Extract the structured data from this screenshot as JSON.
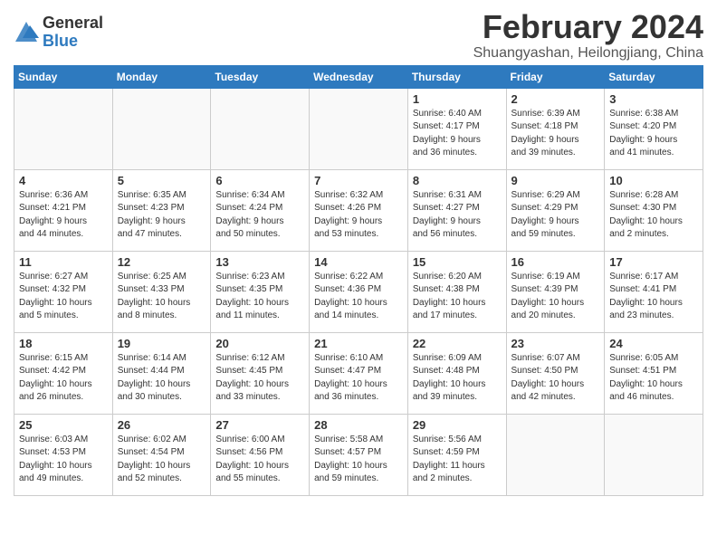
{
  "logo": {
    "general": "General",
    "blue": "Blue"
  },
  "header": {
    "month": "February 2024",
    "location": "Shuangyashan, Heilongjiang, China"
  },
  "weekdays": [
    "Sunday",
    "Monday",
    "Tuesday",
    "Wednesday",
    "Thursday",
    "Friday",
    "Saturday"
  ],
  "weeks": [
    [
      {
        "day": "",
        "info": ""
      },
      {
        "day": "",
        "info": ""
      },
      {
        "day": "",
        "info": ""
      },
      {
        "day": "",
        "info": ""
      },
      {
        "day": "1",
        "info": "Sunrise: 6:40 AM\nSunset: 4:17 PM\nDaylight: 9 hours\nand 36 minutes."
      },
      {
        "day": "2",
        "info": "Sunrise: 6:39 AM\nSunset: 4:18 PM\nDaylight: 9 hours\nand 39 minutes."
      },
      {
        "day": "3",
        "info": "Sunrise: 6:38 AM\nSunset: 4:20 PM\nDaylight: 9 hours\nand 41 minutes."
      }
    ],
    [
      {
        "day": "4",
        "info": "Sunrise: 6:36 AM\nSunset: 4:21 PM\nDaylight: 9 hours\nand 44 minutes."
      },
      {
        "day": "5",
        "info": "Sunrise: 6:35 AM\nSunset: 4:23 PM\nDaylight: 9 hours\nand 47 minutes."
      },
      {
        "day": "6",
        "info": "Sunrise: 6:34 AM\nSunset: 4:24 PM\nDaylight: 9 hours\nand 50 minutes."
      },
      {
        "day": "7",
        "info": "Sunrise: 6:32 AM\nSunset: 4:26 PM\nDaylight: 9 hours\nand 53 minutes."
      },
      {
        "day": "8",
        "info": "Sunrise: 6:31 AM\nSunset: 4:27 PM\nDaylight: 9 hours\nand 56 minutes."
      },
      {
        "day": "9",
        "info": "Sunrise: 6:29 AM\nSunset: 4:29 PM\nDaylight: 9 hours\nand 59 minutes."
      },
      {
        "day": "10",
        "info": "Sunrise: 6:28 AM\nSunset: 4:30 PM\nDaylight: 10 hours\nand 2 minutes."
      }
    ],
    [
      {
        "day": "11",
        "info": "Sunrise: 6:27 AM\nSunset: 4:32 PM\nDaylight: 10 hours\nand 5 minutes."
      },
      {
        "day": "12",
        "info": "Sunrise: 6:25 AM\nSunset: 4:33 PM\nDaylight: 10 hours\nand 8 minutes."
      },
      {
        "day": "13",
        "info": "Sunrise: 6:23 AM\nSunset: 4:35 PM\nDaylight: 10 hours\nand 11 minutes."
      },
      {
        "day": "14",
        "info": "Sunrise: 6:22 AM\nSunset: 4:36 PM\nDaylight: 10 hours\nand 14 minutes."
      },
      {
        "day": "15",
        "info": "Sunrise: 6:20 AM\nSunset: 4:38 PM\nDaylight: 10 hours\nand 17 minutes."
      },
      {
        "day": "16",
        "info": "Sunrise: 6:19 AM\nSunset: 4:39 PM\nDaylight: 10 hours\nand 20 minutes."
      },
      {
        "day": "17",
        "info": "Sunrise: 6:17 AM\nSunset: 4:41 PM\nDaylight: 10 hours\nand 23 minutes."
      }
    ],
    [
      {
        "day": "18",
        "info": "Sunrise: 6:15 AM\nSunset: 4:42 PM\nDaylight: 10 hours\nand 26 minutes."
      },
      {
        "day": "19",
        "info": "Sunrise: 6:14 AM\nSunset: 4:44 PM\nDaylight: 10 hours\nand 30 minutes."
      },
      {
        "day": "20",
        "info": "Sunrise: 6:12 AM\nSunset: 4:45 PM\nDaylight: 10 hours\nand 33 minutes."
      },
      {
        "day": "21",
        "info": "Sunrise: 6:10 AM\nSunset: 4:47 PM\nDaylight: 10 hours\nand 36 minutes."
      },
      {
        "day": "22",
        "info": "Sunrise: 6:09 AM\nSunset: 4:48 PM\nDaylight: 10 hours\nand 39 minutes."
      },
      {
        "day": "23",
        "info": "Sunrise: 6:07 AM\nSunset: 4:50 PM\nDaylight: 10 hours\nand 42 minutes."
      },
      {
        "day": "24",
        "info": "Sunrise: 6:05 AM\nSunset: 4:51 PM\nDaylight: 10 hours\nand 46 minutes."
      }
    ],
    [
      {
        "day": "25",
        "info": "Sunrise: 6:03 AM\nSunset: 4:53 PM\nDaylight: 10 hours\nand 49 minutes."
      },
      {
        "day": "26",
        "info": "Sunrise: 6:02 AM\nSunset: 4:54 PM\nDaylight: 10 hours\nand 52 minutes."
      },
      {
        "day": "27",
        "info": "Sunrise: 6:00 AM\nSunset: 4:56 PM\nDaylight: 10 hours\nand 55 minutes."
      },
      {
        "day": "28",
        "info": "Sunrise: 5:58 AM\nSunset: 4:57 PM\nDaylight: 10 hours\nand 59 minutes."
      },
      {
        "day": "29",
        "info": "Sunrise: 5:56 AM\nSunset: 4:59 PM\nDaylight: 11 hours\nand 2 minutes."
      },
      {
        "day": "",
        "info": ""
      },
      {
        "day": "",
        "info": ""
      }
    ]
  ]
}
